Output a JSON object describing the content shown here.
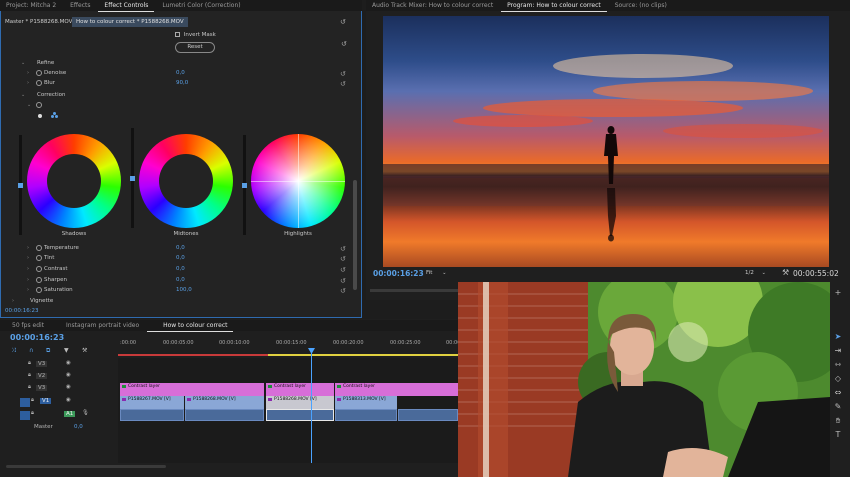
{
  "top_tabs_left": [
    {
      "label": "Project: Mitcha 2"
    },
    {
      "label": "Effects"
    },
    {
      "label": "Effect Controls"
    },
    {
      "label": "Lumetri Color (Correction)"
    }
  ],
  "top_tabs_right": [
    {
      "label": "Audio Track Mixer: How to colour correct"
    },
    {
      "label": "Program: How to colour correct"
    },
    {
      "label": "Source: (no clips)"
    }
  ],
  "effect_controls": {
    "master_label": "Master * P1588268.MOV",
    "sequence_label": "How to colour correct * P1588268.MOV",
    "invert_mask": "Invert Mask",
    "reset_button": "Reset",
    "refine": {
      "title": "Refine",
      "denoise_label": "Denoise",
      "denoise_value": "0,0",
      "blur_label": "Blur",
      "blur_value": "90,0"
    },
    "correction_title": "Correction",
    "wheels": {
      "shadows": "Shadows",
      "midtones": "Midtones",
      "highlights": "Highlights"
    },
    "params": [
      {
        "label": "Temperature",
        "value": "0,0"
      },
      {
        "label": "Tint",
        "value": "0,0"
      },
      {
        "label": "Contrast",
        "value": "0,0"
      },
      {
        "label": "Sharpen",
        "value": "0,0"
      },
      {
        "label": "Saturation",
        "value": "100,0"
      }
    ],
    "vignette": "Vignette",
    "timecode": "00:00:16:23"
  },
  "program_monitor": {
    "timecode": "00:00:16:23",
    "fit": "Fit",
    "resolution": "1/2",
    "duration": "00:00:55:02"
  },
  "timeline": {
    "tabs": [
      {
        "label": "50 fps edit"
      },
      {
        "label": "Instagram portrait video"
      },
      {
        "label": "How to colour correct"
      }
    ],
    "timecode": "00:00:16:23",
    "ruler": [
      ":00:00",
      "00:00:05:00",
      "00:00:10:00",
      "00:00:15:00",
      "00:00:20:00",
      "00:00:25:00",
      "00:00"
    ],
    "tracks": [
      "V3",
      "V2",
      "V1",
      "A1",
      "Master"
    ],
    "master_value": "0,0",
    "clips_v3": [
      "Contrast layer",
      "Contrast layer",
      "Contrast layer"
    ],
    "clips_v1": [
      "P1588267.MOV [V]",
      "P1588268.MOV [V]",
      "P1588268.MOV [V]",
      "P1588313.MOV [V]"
    ]
  },
  "colors": {
    "accent": "#5aa0e6",
    "panel_bg": "#232323",
    "adjust_clip": "#d76ed8",
    "video_clip": "#8aa7d6",
    "audio_clip": "#4a6a9a",
    "playhead": "#4aa3ff"
  }
}
